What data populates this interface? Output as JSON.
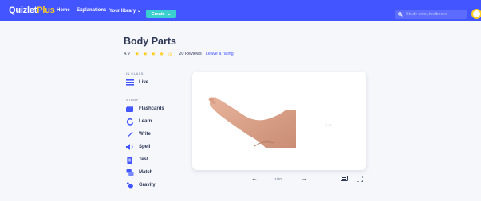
{
  "header": {
    "logo_main": "Quizlet",
    "logo_plus": "Plus",
    "nav": [
      "Home",
      "Explanations",
      "Your library"
    ],
    "create_label": "Create",
    "search_placeholder": "Study sets, textbooks"
  },
  "set": {
    "title": "Body Parts",
    "rating": "4.9",
    "stars": "★ ★ ★ ★ ½",
    "reviews": "20 Reviews",
    "leave_rating": "Leave a rating"
  },
  "sidebar": {
    "in_class_label": "IN CLASS",
    "live_label": "Live",
    "study_label": "STUDY",
    "items": [
      {
        "label": "Flashcards",
        "icon": "flashcards-icon"
      },
      {
        "label": "Learn",
        "icon": "learn-icon"
      },
      {
        "label": "Write",
        "icon": "write-icon"
      },
      {
        "label": "Spell",
        "icon": "spell-icon"
      },
      {
        "label": "Test",
        "icon": "test-icon"
      },
      {
        "label": "Match",
        "icon": "match-icon"
      },
      {
        "label": "Gravity",
        "icon": "gravity-icon"
      }
    ]
  },
  "flashcard": {
    "more_label": "···",
    "counter": "1/20"
  },
  "colors": {
    "brand": "#4255ff",
    "create": "#3ccfcf",
    "star": "#ffcd1f",
    "text": "#2e3856"
  }
}
